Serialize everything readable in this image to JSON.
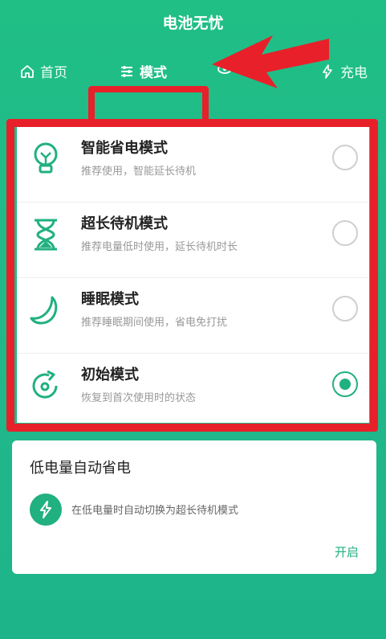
{
  "app": {
    "title": "电池无忧"
  },
  "tabs": [
    {
      "label": "首页",
      "icon": "home-icon"
    },
    {
      "label": "模式",
      "icon": "sliders-icon",
      "active": true
    },
    {
      "label": "",
      "icon": "eye-icon"
    },
    {
      "label": "充电",
      "icon": "bolt-icon"
    }
  ],
  "modes": [
    {
      "title": "智能省电模式",
      "desc": "推荐使用，智能延长待机",
      "icon": "lightbulb-icon",
      "selected": false
    },
    {
      "title": "超长待机模式",
      "desc": "推荐电量低时使用，延长待机时长",
      "icon": "hourglass-icon",
      "selected": false
    },
    {
      "title": "睡眠模式",
      "desc": "推荐睡眠期间使用，省电免打扰",
      "icon": "moon-icon",
      "selected": false
    },
    {
      "title": "初始模式",
      "desc": "恢复到首次使用时的状态",
      "icon": "reset-icon",
      "selected": true
    }
  ],
  "low_battery": {
    "title": "低电量自动省电",
    "desc": "在低电量时自动切换为超长待机模式",
    "icon": "lightning-icon",
    "action": "开启"
  },
  "colors": {
    "accent": "#21b07f",
    "annotation": "#e8202a"
  }
}
